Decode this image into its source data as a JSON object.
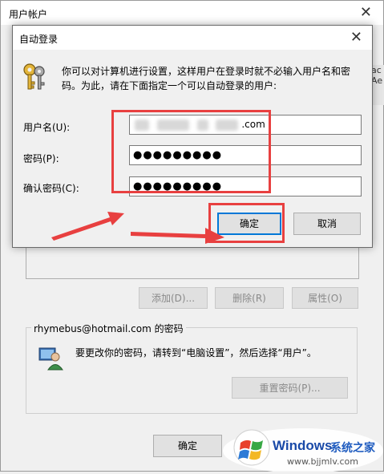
{
  "back_window": {
    "title": "用户帐户",
    "close_glyph": "✕",
    "right_strip": [
      "ac",
      "Ae"
    ],
    "buttons": {
      "add": "添加(D)...",
      "delete": "删除(R)",
      "properties": "属性(O)"
    },
    "password_group": {
      "title": "rhymebus@hotmail.com 的密码",
      "hint": "要更改你的密码，请转到“电脑设置”，然后选择“用户”。",
      "reset_button": "重置密码(P)..."
    },
    "ok_button": "确定"
  },
  "dialog": {
    "title": "自动登录",
    "close_glyph": "✕",
    "icon": "keys-icon",
    "message": "你可以对计算机进行设置，这样用户在登录时就不必输入用户名和密码。为此，请在下面指定一个可以自动登录的用户:",
    "fields": {
      "username_label": "用户名(U):",
      "username_value_suffix": ".com",
      "password_label": "密码(P):",
      "password_value": "●●●●●●●●●",
      "confirm_label": "确认密码(C):",
      "confirm_value": "●●●●●●●●●"
    },
    "ok_button": "确定",
    "cancel_button": "取消"
  },
  "annotation_color": "#e84040",
  "watermark": {
    "brand": "Windows",
    "site_name": "系统之家",
    "url": "www.bjjmlv.com"
  }
}
